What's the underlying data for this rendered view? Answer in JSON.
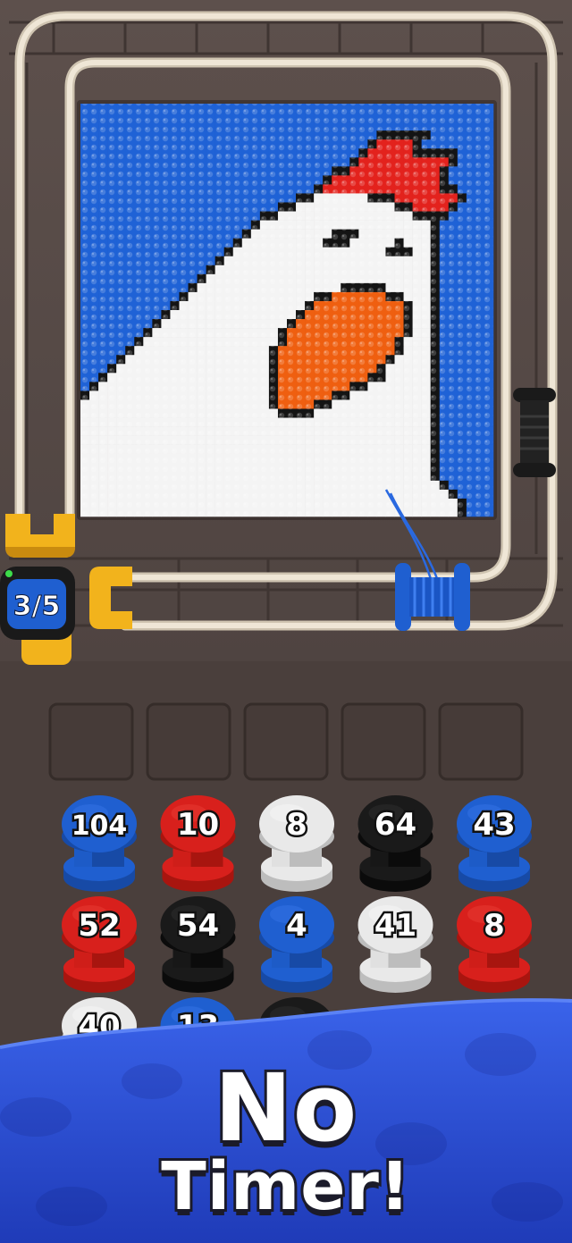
{
  "board": {
    "picture_grid": {
      "cols": 46,
      "rows": 46,
      "palette": {
        "B": "#1f62d6",
        "W": "#f4f4f4",
        "K": "#141414",
        "R": "#e3221d",
        "O": "#ef5f10"
      },
      "rows_data": [
        "BBBBBBBBBBBBBBBBBBBBBBBBBBBBBBBBBBBBBBBBBBBBBB",
        "BBBBBBBBBBBBBBBBBBBBBBBBBBBBBBBBBBBBBBBBBBBBBB",
        "BBBBBBBBBBBBBBBBBBBBBBBBBBBBBBBBBBBBBBBBBBBBBB",
        "BBBBBBBBBBBBBBBBBBBBBBBBBBBBBBBBBKKKKKKBBBBBBB",
        "BBBBBBBBBBBBBBBBBBBBBBBBBBBBBBBBKRRRRKBBBBBBBB",
        "BBBBBBBBBBBBBBBBBBBBBBBBBBBBBBBKRRRRRKKKKKBBBB",
        "BBBBBBBBBBBBBBBBBBBBBBBBBBBBBBKRRRRRRRRRRKBBBB",
        "BBBBBBBBBBBBBBBBBBBBBBBBBBBBKKRRRRRRRRRRKBBBBB",
        "BBBBBBBBBBBBBBBBBBBBBBBBBBBKRRRRRRRRRRRRKBBBBB",
        "BBBBBBBBBBBBBBBBBBBBBBBBBBKRRRRRRRRRRRRRKKBBBB",
        "BBBBBBBBBBBBBBBBBBBBBBBBKKWWWWWWKKKRRRRRRRKBBB",
        "BBBBBBBBBBBBBBBBBBBBBBKKWWWWWWWWWWWKKRRRRKBBBB",
        "BBBBBBBBBBBBBBBBBBBBKKWWWWWWWWWWWWWWWKKKKBBBBB",
        "BBBBBBBBBBBBBBBBBBBKWWWWWWWWWWWWWWWWWWWKBBBBBB",
        "BBBBBBBBBBBBBBBBBBKWWWWWWWWWKKKWWWWWWWWKBBBBBB",
        "BBBBBBBBBBBBBBBBBKWWWWWWWWWKKKWWWWWKWWWKBBBBBB",
        "BBBBBBBBBBBBBBBBKWWWWWWWWWWWWWWWWWKKKWWKBBBBBB",
        "BBBBBBBBBBBBBBBKWWWWWWWWWWWWWWWWWWWWWWWKBBBBBB",
        "BBBBBBBBBBBBBBKWWWWWWWWWWWWWWWWWWWWWWWWKBBBBBB",
        "BBBBBBBBBBBBBKWWWWWWWWWWWWWWWWWWWWWWWWWKBBBBBB",
        "BBBBBBBBBBBBKWWWWWWWWWWWWWWWWKKKKKWWWWWKBBBBBB",
        "BBBBBBBBBBBKWWWWWWWWWWWWWWKKOOOOOOKKWWWKBBBBBB",
        "BBBBBBBBBBKWWWWWWWWWWWWWWKOOOOOOOOOOKWWKBBBBBB",
        "BBBBBBBBBKWWWWWWWWWWWWWWKOOOOOOOOOOOKWWKBBBBBB",
        "BBBBBBBBKWWWWWWWWWWWWWWKOOOOOOOOOOOOKWWKBBBBBB",
        "BBBBBBBKWWWWWWWWWWWWWWKOOOOOOOOOOOOOKWWKBBBBBB",
        "BBBBBBKWWWWWWWWWWWWWWWKOOOOOOOOOOOOKWWWKBBBBBB",
        "BBBBBKWWWWWWWWWWWWWWWKOOOOOOOOOOOOOKWWWKBBBBBB",
        "BBBBKWWWWWWWWWWWWWWWWKOOOOOOOOOOOOKWWWWKBBBBBB",
        "BBBKWWWWWWWWWWWWWWWWWKOOOOOOOOOOOKWWWWWKBBBBBB",
        "BBKWWWWWWWWWWWWWWWWWWKOOOOOOOOOOKKWWWWWKBBBBBB",
        "BKWWWWWWWWWWWWWWWWWWWKOOOOOOOOKKWWWWWWWKBBBBBB",
        "KWWWWWWWWWWWWWWWWWWWWKOOOOOOKKWWWWWWWWWKBBBBBB",
        "WWWWWWWWWWWWWWWWWWWWWKOOOOKKWWWWWWWWWWWKBBBBBB",
        "WWWWWWWWWWWWWWWWWWWWWWKKKKWWWWWWWWWWWWWKBBBBBB",
        "WWWWWWWWWWWWWWWWWWWWWWWWWWWWWWWWWWWWWWWKBBBBBB",
        "WWWWWWWWWWWWWWWWWWWWWWWWWWWWWWWWWWWWWWWKBBBBBB",
        "WWWWWWWWWWWWWWWWWWWWWWWWWWWWWWWWWWWWWWWKBBBBBB",
        "WWWWWWWWWWWWWWWWWWWWWWWWWWWWWWWWWWWWWWWKBBBBBB",
        "WWWWWWWWWWWWWWWWWWWWWWWWWWWWWWWWWWWWWWWKBBBBBB",
        "WWWWWWWWWWWWWWWWWWWWWWWWWWWWWWWWWWWWWWWKBBBBBB",
        "WWWWWWWWWWWWWWWWWWWWWWWWWWWWWWWWWWWWWWWKBBBBBB",
        "WWWWWWWWWWWWWWWWWWWWWWWWWWWWWWWWWWWWWWWWKBBBBB",
        "WWWWWWWWWWWWWWWWWWWWWWWWWWWWWWWWWWWWWWWWWKBBBB",
        "WWWWWWWWWWWWWWWWWWWWWWWWWWWWWWWWWWWWWWWWWWKBBB",
        "WWWWWWWWWWWWWWWWWWWWWWWWWWWWWWWWWWWWWWWWWWKBBB"
      ]
    },
    "counter": {
      "text": "3/5"
    },
    "track_spools": [
      {
        "color": "black",
        "name": "idle-black-spool"
      },
      {
        "color": "blue",
        "name": "active-blue-spool"
      }
    ]
  },
  "slots": {
    "count": 5
  },
  "spools": [
    {
      "label": "104",
      "color": "blue"
    },
    {
      "label": "10",
      "color": "red"
    },
    {
      "label": "8",
      "color": "white"
    },
    {
      "label": "64",
      "color": "black"
    },
    {
      "label": "43",
      "color": "blue"
    },
    {
      "label": "52",
      "color": "red"
    },
    {
      "label": "54",
      "color": "black"
    },
    {
      "label": "4",
      "color": "blue"
    },
    {
      "label": "41",
      "color": "white"
    },
    {
      "label": "8",
      "color": "red"
    },
    {
      "label": "40",
      "color": "white"
    },
    {
      "label": "13",
      "color": "blue"
    },
    {
      "label": "",
      "color": "black"
    }
  ],
  "colors": {
    "blue": "#1f5fd0",
    "red": "#d8201c",
    "white": "#e9e9e9",
    "black": "#1a1a1a",
    "track": "#e2d8c6",
    "yellow": "#f2b31c",
    "board": "#5a4d49",
    "background": "#4a3f3c",
    "banner": "#2f4fd8"
  },
  "banner": {
    "line1": "No",
    "line2": "Timer!"
  }
}
